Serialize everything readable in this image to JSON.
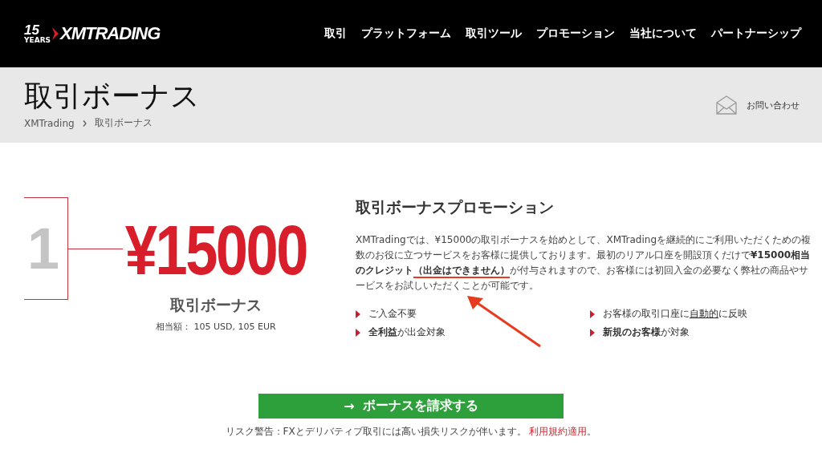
{
  "header": {
    "logo": {
      "years_number": "15",
      "years_label": "YEARS",
      "brand": "XMTRADING"
    },
    "nav": [
      "取引",
      "プラットフォーム",
      "取引ツール",
      "プロモーション",
      "当社について",
      "パートナーシップ"
    ]
  },
  "title_band": {
    "title": "取引ボーナス",
    "breadcrumb": [
      "XMTrading",
      "取引ボーナス"
    ],
    "contact": "お問い合わせ"
  },
  "bonus": {
    "step": "1",
    "amount": "¥15000",
    "label": "取引ボーナス",
    "equivalent": "相当額： 105 USD, 105 EUR"
  },
  "promotion": {
    "title": "取引ボーナスプロモーション",
    "description": [
      {
        "text": "XMTradingでは、¥15000の取引ボーナスを始めとして、XMTradingを継続的にご利用いただくための複数のお役に立つサービスをお客様に提供しております。最初のリアル口座を開設頂くだけで",
        "bold": false,
        "underlined": false
      },
      {
        "text": "¥15000相当のクレジット",
        "bold": true,
        "underlined": false
      },
      {
        "text": "（出金はできません）",
        "bold": true,
        "underlined": true
      },
      {
        "text": "が付与されますので、お客様には初回入金の必要なく弊社の商品やサービスをお試しいただくことが可能です。",
        "bold": false,
        "underlined": false
      }
    ],
    "features": [
      {
        "text": "ご入金不要"
      },
      {
        "text": "お客様の取引口座に",
        "link": "自動的",
        "after": "に反映"
      },
      {
        "text": "**全利益**が出金対象"
      },
      {
        "text": "**新規のお客様**が対象"
      }
    ]
  },
  "cta": {
    "arrow": "→",
    "label": "ボーナスを請求する"
  },
  "risk": {
    "text": "リスク警告：FXとデリバティブ取引には高い損失リスクが伴います。",
    "link": "利用規約適用",
    "end": "。"
  }
}
